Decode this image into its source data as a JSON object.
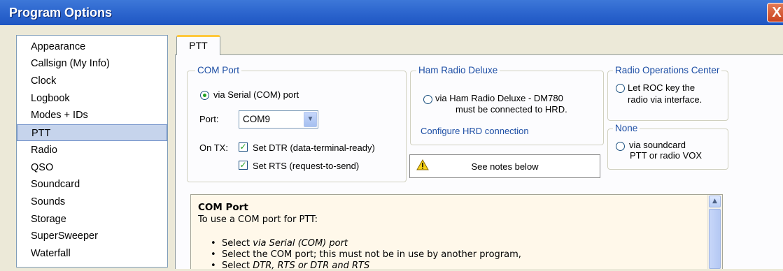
{
  "window": {
    "title": "Program Options",
    "close_label": "X"
  },
  "sidebar": {
    "items": [
      {
        "label": "Appearance"
      },
      {
        "label": "Callsign (My Info)"
      },
      {
        "label": "Clock"
      },
      {
        "label": "Logbook"
      },
      {
        "label": "Modes + IDs"
      },
      {
        "label": "PTT",
        "selected": true
      },
      {
        "label": "Radio"
      },
      {
        "label": "QSO"
      },
      {
        "label": "Soundcard"
      },
      {
        "label": "Sounds"
      },
      {
        "label": "Storage"
      },
      {
        "label": "SuperSweeper"
      },
      {
        "label": "Waterfall"
      }
    ]
  },
  "tabs": [
    {
      "label": "PTT",
      "active": true
    }
  ],
  "com_port": {
    "legend": "COM Port",
    "serial_label": "via Serial (COM) port",
    "serial_selected": true,
    "port_label": "Port:",
    "port_value": "COM9",
    "ontx_label": "On TX:",
    "dtr_label": "Set DTR (data-terminal-ready)",
    "dtr_checked": true,
    "rts_label": "Set RTS (request-to-send)",
    "rts_checked": true
  },
  "ham_radio_deluxe": {
    "legend": "Ham Radio Deluxe",
    "option_line1": "via Ham Radio Deluxe - DM780",
    "option_line2": "must be connected to HRD.",
    "selected": false,
    "configure_link": "Configure HRD connection"
  },
  "roc": {
    "legend": "Radio Operations Center",
    "option_line1": "Let ROC key the",
    "option_line2": "radio via interface.",
    "selected": false
  },
  "none_group": {
    "legend": "None",
    "option_line1": "via soundcard",
    "option_line2": "PTT or radio VOX",
    "selected": false
  },
  "notes_button": {
    "label": "See notes below",
    "icon": "warning-icon"
  },
  "notes": {
    "heading": "COM Port",
    "intro": "To use a COM port for PTT:",
    "bullets": [
      {
        "prefix": "Select ",
        "emph": "via Serial (COM) port",
        "suffix": ""
      },
      {
        "prefix": "Select the COM port; this must not be in use by another program,",
        "emph": "",
        "suffix": ""
      },
      {
        "prefix": "Select ",
        "emph": "DTR, RTS or DTR and RTS",
        "suffix": ""
      }
    ]
  },
  "colors": {
    "titlebar": "#2E67CF",
    "group_legend": "#1E4FA5",
    "selection": "#C6D4EC",
    "notes_bg": "#FFF8EA"
  }
}
